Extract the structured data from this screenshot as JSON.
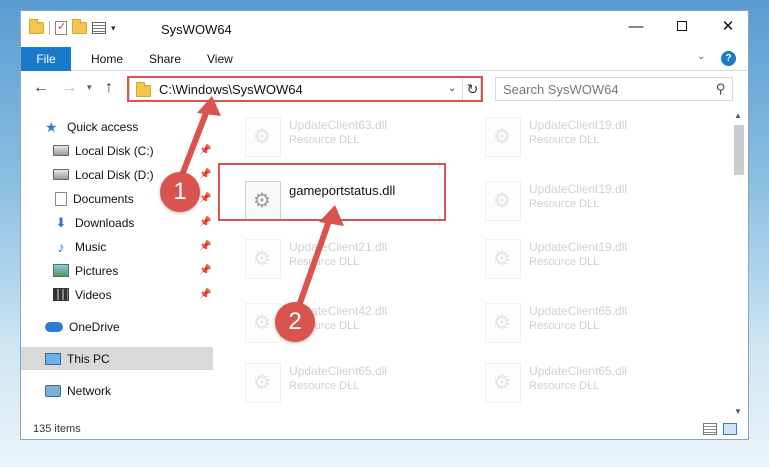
{
  "window": {
    "title": "SysWOW64"
  },
  "ribbon": {
    "file": "File",
    "home": "Home",
    "share": "Share",
    "view": "View"
  },
  "address": {
    "path": "C:\\Windows\\SysWOW64"
  },
  "search": {
    "placeholder": "Search SysWOW64"
  },
  "sidebar": {
    "items": [
      {
        "label": "Quick access"
      },
      {
        "label": "Local Disk (C:)"
      },
      {
        "label": "Local Disk (D:)"
      },
      {
        "label": "Documents"
      },
      {
        "label": "Downloads"
      },
      {
        "label": "Music"
      },
      {
        "label": "Pictures"
      },
      {
        "label": "Videos"
      },
      {
        "label": "OneDrive"
      },
      {
        "label": "This PC"
      },
      {
        "label": "Network"
      }
    ]
  },
  "files": [
    {
      "name": "UpdateClient63.dll",
      "type": "Resource DLL"
    },
    {
      "name": "UpdateClient19.dll",
      "type": "Resource DLL"
    },
    {
      "name": "gameportstatus.dll",
      "type": ""
    },
    {
      "name": "UpdateClient19.dll",
      "type": "Resource DLL"
    },
    {
      "name": "UpdateClient21.dll",
      "type": "Resource DLL"
    },
    {
      "name": "UpdateClient19.dll",
      "type": "Resource DLL"
    },
    {
      "name": "UpdateClient42.dll",
      "type": "Resource DLL"
    },
    {
      "name": "UpdateClient65.dll",
      "type": "Resource DLL"
    },
    {
      "name": "UpdateClient65.dll",
      "type": "Resource DLL"
    },
    {
      "name": "UpdateClient65.dll",
      "type": "Resource DLL"
    }
  ],
  "status": {
    "count": "135 items"
  },
  "annotations": {
    "step1": "1",
    "step2": "2"
  },
  "colors": {
    "accent": "#1979ca",
    "highlight": "#d9534f"
  }
}
